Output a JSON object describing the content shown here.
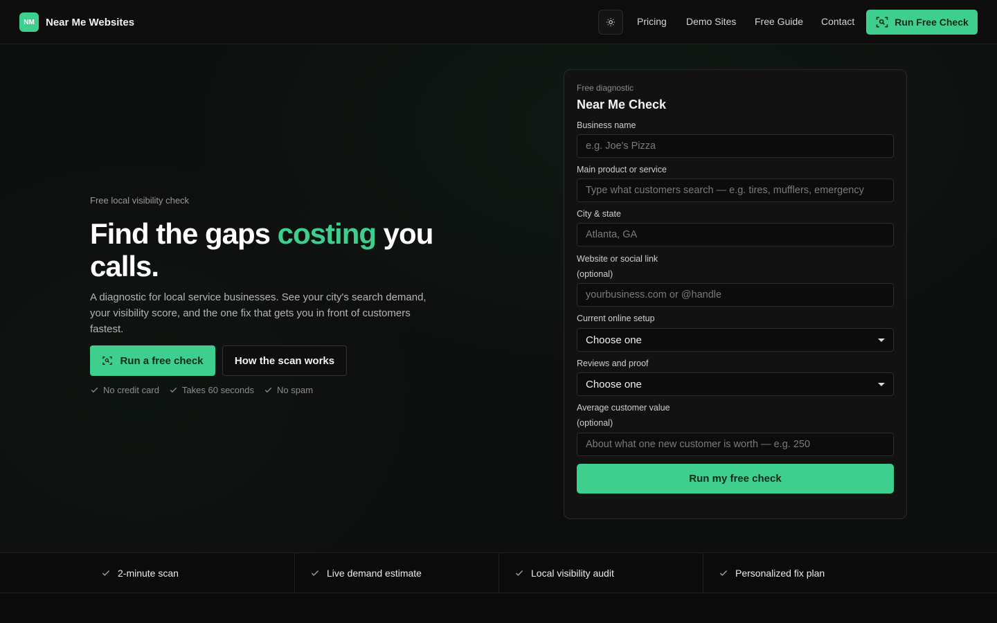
{
  "header": {
    "logo_badge": "NM",
    "logo_text": "Near Me Websites",
    "nav": [
      "Pricing",
      "Demo Sites",
      "Free Guide",
      "Contact"
    ],
    "cta": "Run Free Check"
  },
  "hero": {
    "eyebrow": "Free local visibility check",
    "headline_pre": "Find the gaps ",
    "headline_accent": "costing",
    "headline_post": " you calls.",
    "subtext": "A diagnostic for local service businesses. See your city's search demand, your visibility score, and the one fix that gets you in front of customers fastest.",
    "primary_button": "Run a free check",
    "secondary_button": "How the scan works",
    "perks": [
      "No credit card",
      "Takes 60 seconds",
      "No spam"
    ]
  },
  "form": {
    "eyebrow": "Free diagnostic",
    "title": "Near Me Check",
    "business_name": {
      "label": "Business name",
      "placeholder": "e.g. Joe's Pizza"
    },
    "service": {
      "label": "Main product or service",
      "placeholder": "Type what customers search — e.g. tires, mufflers, emergency"
    },
    "city": {
      "label": "City & state",
      "placeholder": "Atlanta, GA"
    },
    "website": {
      "label": "Website or social link",
      "optional": "(optional)",
      "placeholder": "yourbusiness.com or @handle"
    },
    "setup": {
      "label": "Current online setup",
      "value": "Choose one"
    },
    "reviews": {
      "label": "Reviews and proof",
      "value": "Choose one"
    },
    "value": {
      "label": "Average customer value",
      "optional": "(optional)",
      "placeholder": "About what one new customer is worth — e.g. 250"
    },
    "submit": "Run my free check"
  },
  "features": [
    "2-minute scan",
    "Live demand estimate",
    "Local visibility audit",
    "Personalized fix plan"
  ],
  "colors": {
    "accent": "#3ecf8e",
    "background": "#0b0b0b",
    "card": "#121212"
  }
}
